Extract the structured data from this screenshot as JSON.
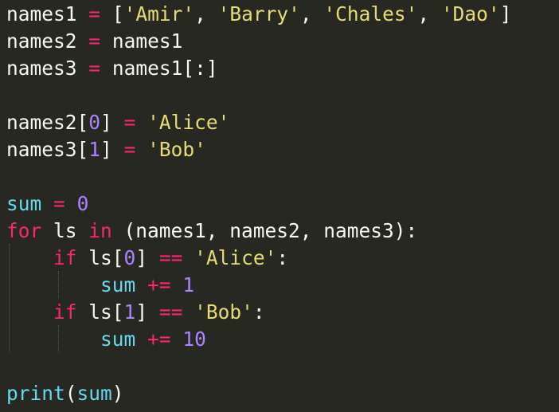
{
  "editor": {
    "theme_colors": {
      "background": "#272822",
      "plain": "#F8F8F2",
      "keyword": "#F92672",
      "number": "#AE81FF",
      "string": "#E6DB74",
      "builtin": "#66D9EF"
    },
    "lines": [
      {
        "tokens": [
          {
            "text": "names1",
            "kind": "plain"
          },
          {
            "text": " ",
            "kind": "plain"
          },
          {
            "text": "=",
            "kind": "op"
          },
          {
            "text": " ",
            "kind": "plain"
          },
          {
            "text": "[",
            "kind": "plain"
          },
          {
            "text": "'Amir'",
            "kind": "str"
          },
          {
            "text": ", ",
            "kind": "plain"
          },
          {
            "text": "'Barry'",
            "kind": "str"
          },
          {
            "text": ", ",
            "kind": "plain"
          },
          {
            "text": "'Chales'",
            "kind": "str"
          },
          {
            "text": ", ",
            "kind": "plain"
          },
          {
            "text": "'Dao'",
            "kind": "str"
          },
          {
            "text": "]",
            "kind": "plain"
          }
        ]
      },
      {
        "tokens": [
          {
            "text": "names2",
            "kind": "plain"
          },
          {
            "text": " ",
            "kind": "plain"
          },
          {
            "text": "=",
            "kind": "op"
          },
          {
            "text": " ",
            "kind": "plain"
          },
          {
            "text": "names1",
            "kind": "plain"
          }
        ]
      },
      {
        "tokens": [
          {
            "text": "names3",
            "kind": "plain"
          },
          {
            "text": " ",
            "kind": "plain"
          },
          {
            "text": "=",
            "kind": "op"
          },
          {
            "text": " ",
            "kind": "plain"
          },
          {
            "text": "names1[:]",
            "kind": "plain"
          }
        ]
      },
      {
        "tokens": []
      },
      {
        "tokens": [
          {
            "text": "names2[",
            "kind": "plain"
          },
          {
            "text": "0",
            "kind": "num"
          },
          {
            "text": "]",
            "kind": "plain"
          },
          {
            "text": " ",
            "kind": "plain"
          },
          {
            "text": "=",
            "kind": "op"
          },
          {
            "text": " ",
            "kind": "plain"
          },
          {
            "text": "'Alice'",
            "kind": "str"
          }
        ]
      },
      {
        "tokens": [
          {
            "text": "names3[",
            "kind": "plain"
          },
          {
            "text": "1",
            "kind": "num"
          },
          {
            "text": "]",
            "kind": "plain"
          },
          {
            "text": " ",
            "kind": "plain"
          },
          {
            "text": "=",
            "kind": "op"
          },
          {
            "text": " ",
            "kind": "plain"
          },
          {
            "text": "'Bob'",
            "kind": "str"
          }
        ]
      },
      {
        "tokens": []
      },
      {
        "tokens": [
          {
            "text": "sum",
            "kind": "builtin"
          },
          {
            "text": " ",
            "kind": "plain"
          },
          {
            "text": "=",
            "kind": "op"
          },
          {
            "text": " ",
            "kind": "plain"
          },
          {
            "text": "0",
            "kind": "num"
          }
        ]
      },
      {
        "tokens": [
          {
            "text": "for",
            "kind": "kw"
          },
          {
            "text": " ls ",
            "kind": "plain"
          },
          {
            "text": "in",
            "kind": "kw"
          },
          {
            "text": " (names1, names2, names3):",
            "kind": "plain"
          }
        ]
      },
      {
        "tokens": [
          {
            "text": "    ",
            "kind": "plain"
          },
          {
            "text": "if",
            "kind": "kw"
          },
          {
            "text": " ls[",
            "kind": "plain"
          },
          {
            "text": "0",
            "kind": "num"
          },
          {
            "text": "]",
            "kind": "plain"
          },
          {
            "text": " ",
            "kind": "plain"
          },
          {
            "text": "==",
            "kind": "op"
          },
          {
            "text": " ",
            "kind": "plain"
          },
          {
            "text": "'Alice'",
            "kind": "str"
          },
          {
            "text": ":",
            "kind": "plain"
          }
        ]
      },
      {
        "tokens": [
          {
            "text": "        ",
            "kind": "plain"
          },
          {
            "text": "sum",
            "kind": "builtin"
          },
          {
            "text": " ",
            "kind": "plain"
          },
          {
            "text": "+=",
            "kind": "op"
          },
          {
            "text": " ",
            "kind": "plain"
          },
          {
            "text": "1",
            "kind": "num"
          }
        ]
      },
      {
        "tokens": [
          {
            "text": "    ",
            "kind": "plain"
          },
          {
            "text": "if",
            "kind": "kw"
          },
          {
            "text": " ls[",
            "kind": "plain"
          },
          {
            "text": "1",
            "kind": "num"
          },
          {
            "text": "]",
            "kind": "plain"
          },
          {
            "text": " ",
            "kind": "plain"
          },
          {
            "text": "==",
            "kind": "op"
          },
          {
            "text": " ",
            "kind": "plain"
          },
          {
            "text": "'Bob'",
            "kind": "str"
          },
          {
            "text": ":",
            "kind": "plain"
          }
        ]
      },
      {
        "tokens": [
          {
            "text": "        ",
            "kind": "plain"
          },
          {
            "text": "sum",
            "kind": "builtin"
          },
          {
            "text": " ",
            "kind": "plain"
          },
          {
            "text": "+=",
            "kind": "op"
          },
          {
            "text": " ",
            "kind": "plain"
          },
          {
            "text": "10",
            "kind": "num"
          }
        ]
      },
      {
        "tokens": []
      },
      {
        "tokens": [
          {
            "text": "print",
            "kind": "builtin"
          },
          {
            "text": "(",
            "kind": "plain"
          },
          {
            "text": "sum",
            "kind": "builtin"
          },
          {
            "text": ")",
            "kind": "plain"
          }
        ]
      }
    ]
  }
}
